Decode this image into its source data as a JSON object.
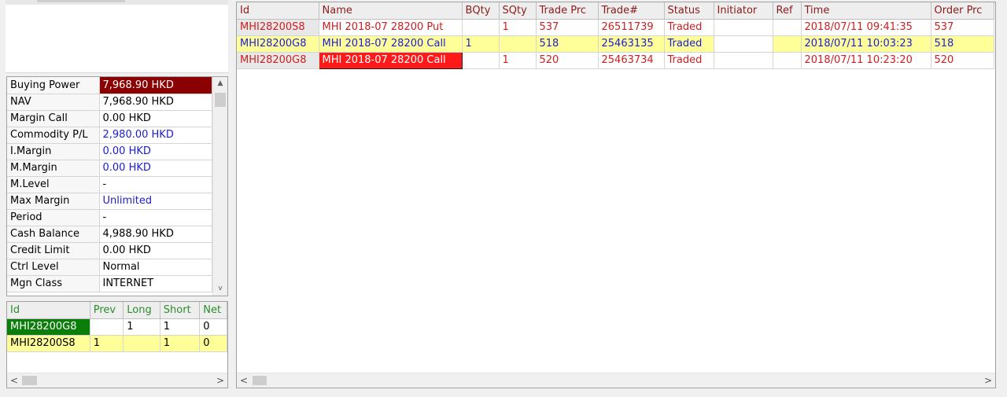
{
  "account": {
    "rows": [
      {
        "label": "Buying Power",
        "value": "7,968.90 HKD"
      },
      {
        "label": "NAV",
        "value": "7,968.90 HKD"
      },
      {
        "label": "Margin Call",
        "value": "0.00 HKD"
      },
      {
        "label": "Commodity P/L",
        "value": "2,980.00 HKD"
      },
      {
        "label": "I.Margin",
        "value": "0.00 HKD"
      },
      {
        "label": "M.Margin",
        "value": "0.00 HKD"
      },
      {
        "label": "M.Level",
        "value": "-"
      },
      {
        "label": "Max Margin",
        "value": "Unlimited"
      },
      {
        "label": "Period",
        "value": "-"
      },
      {
        "label": "Cash Balance",
        "value": "4,988.90 HKD"
      },
      {
        "label": "Credit Limit",
        "value": "0.00 HKD"
      },
      {
        "label": "Ctrl Level",
        "value": "Normal"
      },
      {
        "label": "Mgn Class",
        "value": "INTERNET"
      }
    ]
  },
  "positions": {
    "columns": [
      "Id",
      "Prev",
      "Long",
      "Short",
      "Net"
    ],
    "rows": [
      {
        "id": "MHI28200G8",
        "prev": "",
        "long": "1",
        "short": "1",
        "net": "0"
      },
      {
        "id": "MHI28200S8",
        "prev": "1",
        "long": "",
        "short": "1",
        "net": "0"
      }
    ]
  },
  "orders": {
    "columns": [
      "Id",
      "Name",
      "BQty",
      "SQty",
      "Trade Prc",
      "Trade#",
      "Status",
      "Initiator",
      "Ref",
      "Time",
      "Order Prc"
    ],
    "rows": [
      {
        "id": "MHI28200S8",
        "name": "MHI 2018-07 28200 Put",
        "bqty": "",
        "sqty": "1",
        "trade_prc": "537",
        "trade_no": "26511739",
        "status": "Traded",
        "initiator": "",
        "ref": "",
        "time": "2018/07/11 09:41:35",
        "order_prc": "537"
      },
      {
        "id": "MHI28200G8",
        "name": "MHI 2018-07 28200 Call",
        "bqty": "1",
        "sqty": "",
        "trade_prc": "518",
        "trade_no": "25463135",
        "status": "Traded",
        "initiator": "",
        "ref": "",
        "time": "2018/07/11 10:03:23",
        "order_prc": "518"
      },
      {
        "id": "MHI28200G8",
        "name": "MHI 2018-07 28200 Call",
        "bqty": "",
        "sqty": "1",
        "trade_prc": "520",
        "trade_no": "25463734",
        "status": "Traded",
        "initiator": "",
        "ref": "",
        "time": "2018/07/11 10:23:20",
        "order_prc": "520"
      }
    ]
  },
  "scroll": {
    "left_arrow": "<",
    "right_arrow": ">",
    "up_arrow": "▲",
    "down_arrow": "v"
  },
  "colors": {
    "buying_power_bg": "#8b0000",
    "highlight_row": "#ffff99",
    "position_id_bg": "#0a7d0a",
    "selected_name_bg": "#ff1a1a",
    "sell_text": "#cc2020",
    "buy_text": "#1b1bd6",
    "order_header_text": "#8b1a1a",
    "position_header_text": "#2e8b2e"
  }
}
